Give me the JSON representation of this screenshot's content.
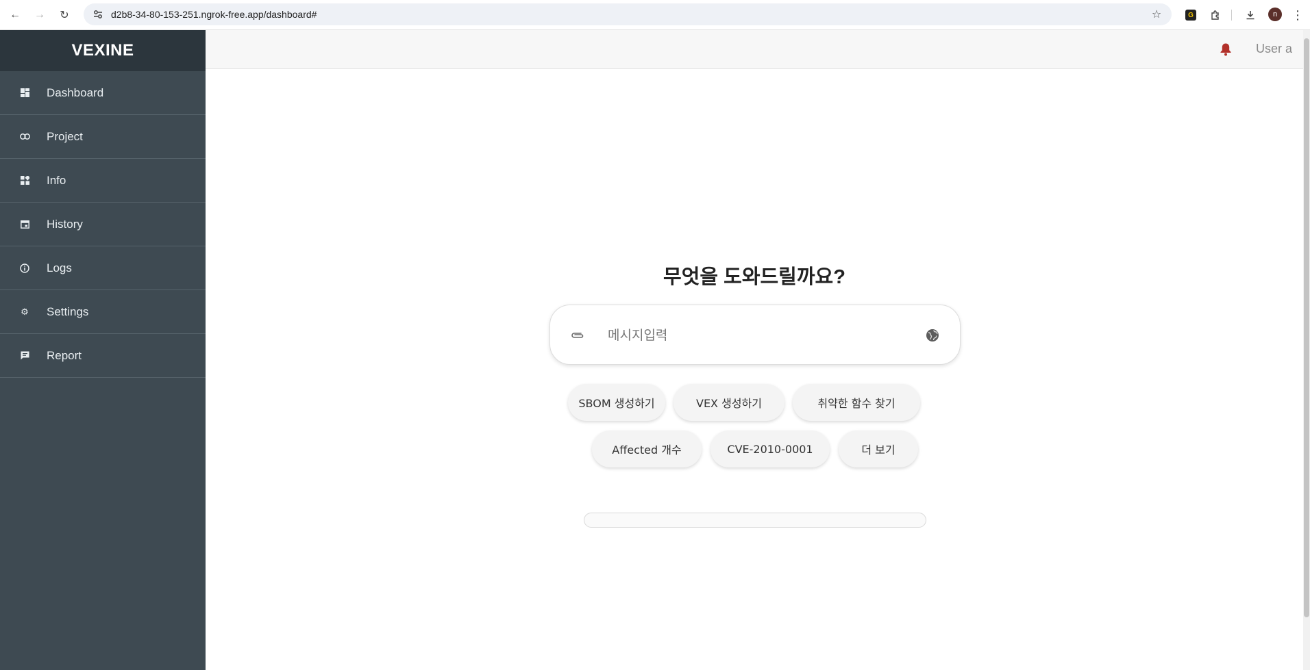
{
  "browser": {
    "url": "d2b8-34-80-153-251.ngrok-free.app/dashboard#",
    "profile_initial": "n"
  },
  "sidebar": {
    "brand": "VEXINE",
    "items": [
      {
        "label": "Dashboard",
        "icon": "dashboard-icon"
      },
      {
        "label": "Project",
        "icon": "link-icon"
      },
      {
        "label": "Info",
        "icon": "widgets-icon"
      },
      {
        "label": "History",
        "icon": "calendar-icon"
      },
      {
        "label": "Logs",
        "icon": "info-circle-icon"
      },
      {
        "label": "Settings",
        "icon": "gear-icon"
      },
      {
        "label": "Report",
        "icon": "chat-bubble-icon"
      }
    ],
    "colors": {
      "background": "#3e4a52",
      "brand_background": "#2c363d"
    }
  },
  "header": {
    "user_label": "User a",
    "bell_color": "#b2312a"
  },
  "main": {
    "headline": "무엇을 도와드릴까요?",
    "chat": {
      "placeholder": "메시지입력",
      "value": ""
    },
    "suggestions": [
      "SBOM 생성하기",
      "VEX 생성하기",
      "취약한 함수 찾기",
      "Affected 개수",
      "CVE-2010-0001",
      "더 보기"
    ],
    "progress": 0
  }
}
